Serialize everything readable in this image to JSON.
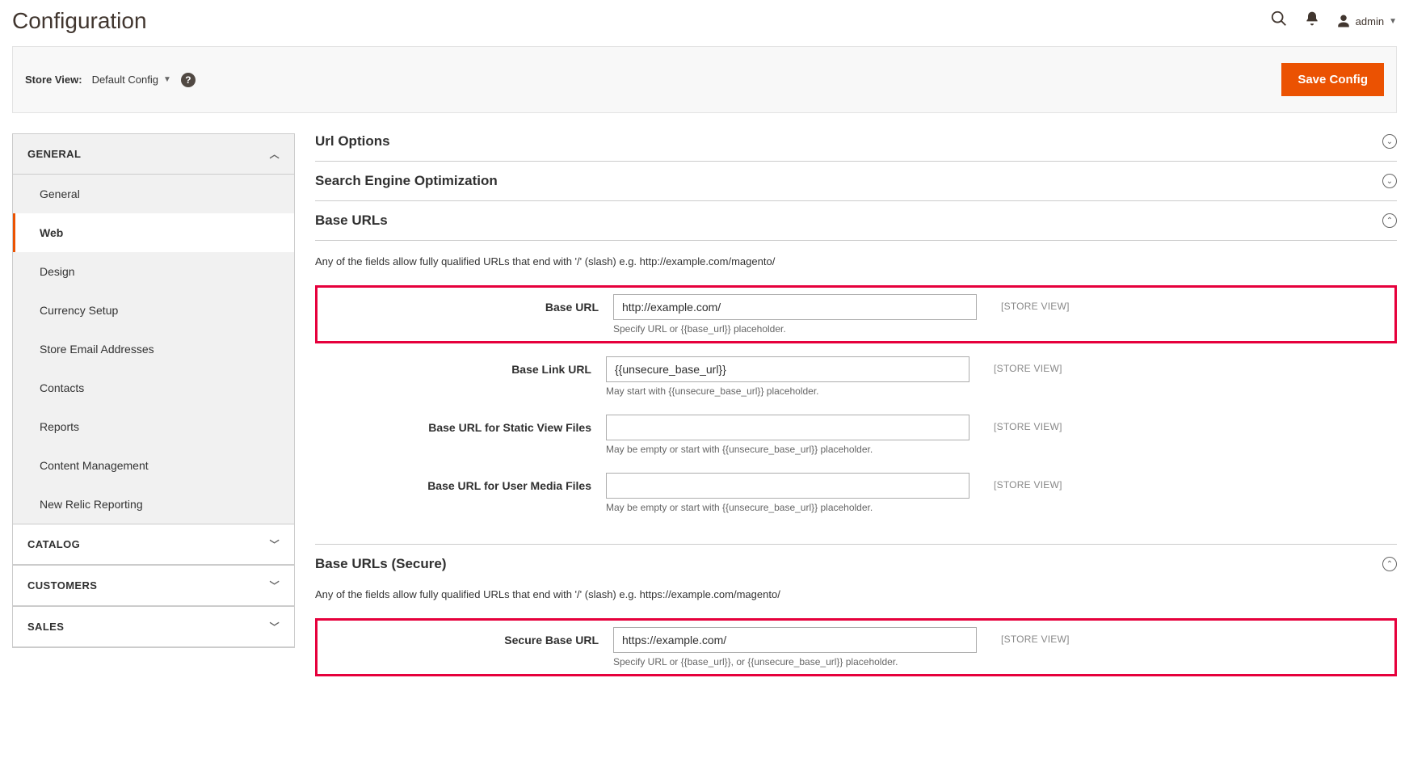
{
  "header": {
    "title": "Configuration",
    "admin_label": "admin"
  },
  "toolbar": {
    "store_view_label": "Store View:",
    "store_view_value": "Default Config",
    "save_label": "Save Config"
  },
  "sidebar": {
    "sections": [
      {
        "label": "GENERAL",
        "expanded": true,
        "items": [
          {
            "label": "General",
            "active": false
          },
          {
            "label": "Web",
            "active": true
          },
          {
            "label": "Design",
            "active": false
          },
          {
            "label": "Currency Setup",
            "active": false
          },
          {
            "label": "Store Email Addresses",
            "active": false
          },
          {
            "label": "Contacts",
            "active": false
          },
          {
            "label": "Reports",
            "active": false
          },
          {
            "label": "Content Management",
            "active": false
          },
          {
            "label": "New Relic Reporting",
            "active": false
          }
        ]
      },
      {
        "label": "CATALOG",
        "expanded": false
      },
      {
        "label": "CUSTOMERS",
        "expanded": false
      },
      {
        "label": "SALES",
        "expanded": false
      }
    ]
  },
  "content": {
    "collapsed_sections": [
      {
        "title": "Url Options"
      },
      {
        "title": "Search Engine Optimization"
      }
    ],
    "base_urls": {
      "title": "Base URLs",
      "description": "Any of the fields allow fully qualified URLs that end with '/' (slash) e.g. http://example.com/magento/",
      "fields": [
        {
          "label": "Base URL",
          "value": "http://example.com/",
          "note": "Specify URL or {{base_url}} placeholder.",
          "scope": "[STORE VIEW]",
          "highlight": true
        },
        {
          "label": "Base Link URL",
          "value": "{{unsecure_base_url}}",
          "note": "May start with {{unsecure_base_url}} placeholder.",
          "scope": "[STORE VIEW]",
          "highlight": false
        },
        {
          "label": "Base URL for Static View Files",
          "value": "",
          "note": "May be empty or start with {{unsecure_base_url}} placeholder.",
          "scope": "[STORE VIEW]",
          "highlight": false
        },
        {
          "label": "Base URL for User Media Files",
          "value": "",
          "note": "May be empty or start with {{unsecure_base_url}} placeholder.",
          "scope": "[STORE VIEW]",
          "highlight": false
        }
      ]
    },
    "base_urls_secure": {
      "title": "Base URLs (Secure)",
      "description": "Any of the fields allow fully qualified URLs that end with '/' (slash) e.g. https://example.com/magento/",
      "fields": [
        {
          "label": "Secure Base URL",
          "value": "https://example.com/",
          "note": "Specify URL or {{base_url}}, or {{unsecure_base_url}} placeholder.",
          "scope": "[STORE VIEW]",
          "highlight": true
        }
      ]
    }
  }
}
